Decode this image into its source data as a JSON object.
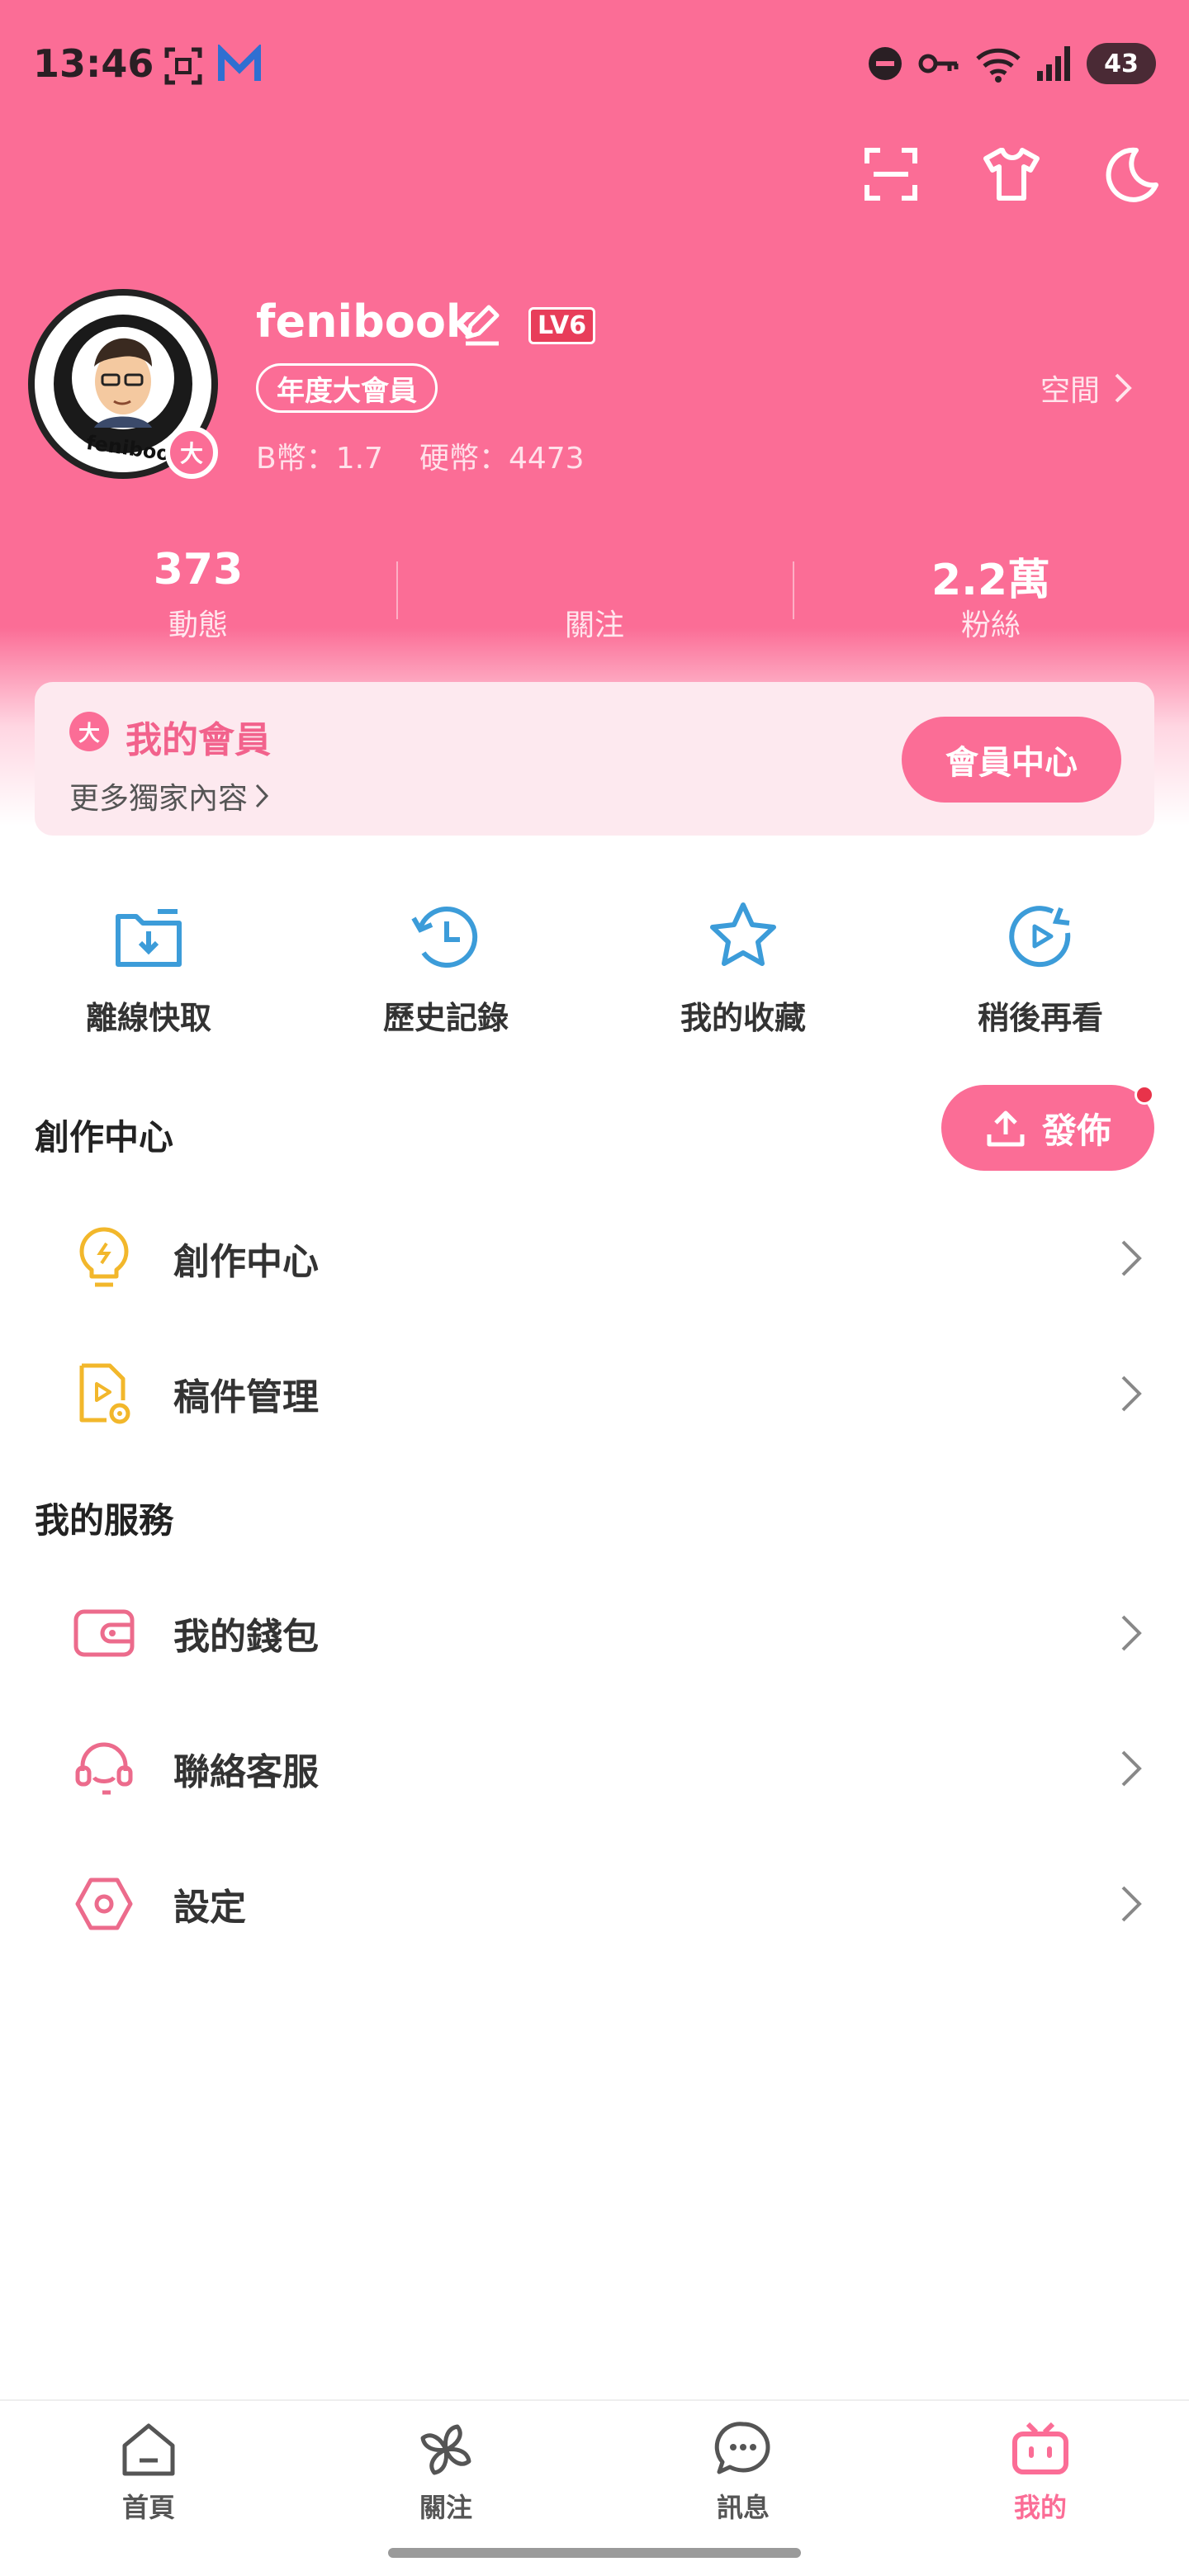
{
  "status_bar": {
    "time": "13:46",
    "battery": "43"
  },
  "profile": {
    "username": "fenibook",
    "level": "LV6",
    "vip_tag": "年度大會員",
    "avatar_badge": "大",
    "b_coins": "B幣：1.7",
    "hard_coins": "硬幣：4473",
    "space_link": "空間"
  },
  "stats": [
    {
      "value": "373",
      "label": "動態"
    },
    {
      "value": "",
      "label": "關注"
    },
    {
      "value": "2.2萬",
      "label": "粉絲"
    }
  ],
  "member_card": {
    "icon_text": "大",
    "title": "我的會員",
    "subtitle": "更多獨家內容",
    "button": "會員中心"
  },
  "quick_actions": [
    {
      "label": "離線快取",
      "icon": "offline-download-icon"
    },
    {
      "label": "歷史記錄",
      "icon": "history-icon"
    },
    {
      "label": "我的收藏",
      "icon": "star-icon"
    },
    {
      "label": "稍後再看",
      "icon": "watch-later-icon"
    }
  ],
  "creation_section": {
    "title": "創作中心",
    "publish_button": "發佈",
    "items": [
      {
        "label": "創作中心",
        "icon": "lightbulb-icon"
      },
      {
        "label": "稿件管理",
        "icon": "manuscript-icon"
      }
    ]
  },
  "services_section": {
    "title": "我的服務",
    "items": [
      {
        "label": "我的錢包",
        "icon": "wallet-icon"
      },
      {
        "label": "聯絡客服",
        "icon": "headset-icon"
      },
      {
        "label": "設定",
        "icon": "settings-icon"
      }
    ]
  },
  "bottom_nav": [
    {
      "label": "首頁",
      "icon": "home-icon"
    },
    {
      "label": "關注",
      "icon": "pinwheel-icon"
    },
    {
      "label": "訊息",
      "icon": "message-icon"
    },
    {
      "label": "我的",
      "icon": "tv-icon",
      "active": true
    }
  ],
  "colors": {
    "brand_pink": "#fb6d96",
    "blue_icons": "#3c9cd9",
    "yellow_icons": "#f2b72b",
    "pink_icons": "#ec6b8c"
  }
}
